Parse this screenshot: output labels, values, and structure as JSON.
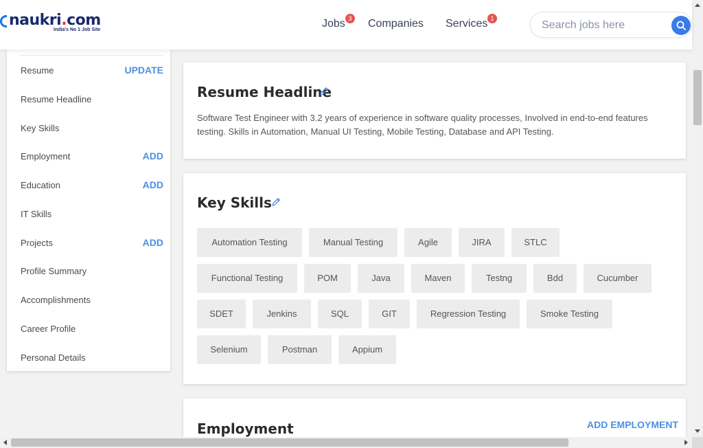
{
  "logo": {
    "brand_a": "naukri",
    "brand_dot": ".",
    "brand_b": "com",
    "tagline": "India's No 1 Job Site"
  },
  "nav": {
    "jobs": {
      "label": "Jobs",
      "badge": "3"
    },
    "companies": {
      "label": "Companies"
    },
    "services": {
      "label": "Services",
      "badge": "1"
    }
  },
  "search": {
    "placeholder": "Search jobs here"
  },
  "sidebar": {
    "items": [
      {
        "label": "Resume",
        "action": "UPDATE"
      },
      {
        "label": "Resume Headline",
        "action": ""
      },
      {
        "label": "Key Skills",
        "action": ""
      },
      {
        "label": "Employment",
        "action": "ADD"
      },
      {
        "label": "Education",
        "action": "ADD"
      },
      {
        "label": "IT Skills",
        "action": ""
      },
      {
        "label": "Projects",
        "action": "ADD"
      },
      {
        "label": "Profile Summary",
        "action": ""
      },
      {
        "label": "Accomplishments",
        "action": ""
      },
      {
        "label": "Career Profile",
        "action": ""
      },
      {
        "label": "Personal Details",
        "action": ""
      }
    ]
  },
  "resume_headline": {
    "title": "Resume Headline",
    "text": "Software Test Engineer with 3.2 years of experience in software quality processes, Involved in end-to-end features testing. Skills in Automation, Manual UI Testing, Mobile Testing, Database and API Testing."
  },
  "key_skills": {
    "title": "Key Skills",
    "skills": [
      "Automation Testing",
      "Manual Testing",
      "Agile",
      "JIRA",
      "STLC",
      "Functional Testing",
      "POM",
      "Java",
      "Maven",
      "Testng",
      "Bdd",
      "Cucumber",
      "SDET",
      "Jenkins",
      "SQL",
      "GIT",
      "Regression Testing",
      "Smoke Testing",
      "Selenium",
      "Postman",
      "Appium"
    ]
  },
  "employment": {
    "title": "Employment",
    "add_label": "ADD EMPLOYMENT"
  },
  "colors": {
    "accent": "#4a90e2",
    "badge": "#e05654",
    "brand": "#1a2a6c",
    "chip_bg": "#ececec"
  }
}
